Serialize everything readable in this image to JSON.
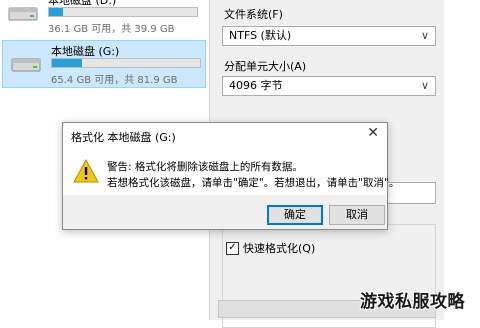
{
  "explorer": {
    "drives": [
      {
        "name": "本地磁盘 (D:)",
        "free_text": "36.1 GB 可用，共 39.9 GB",
        "used_fraction": 0.095,
        "icon": "hard-drive-icon"
      },
      {
        "name": "本地磁盘 (G:)",
        "free_text": "65.4 GB 可用，共 81.9 GB",
        "used_fraction": 0.2,
        "icon": "hard-drive-icon"
      }
    ]
  },
  "format_dialog": {
    "filesystem_label": "文件系统(F)",
    "filesystem_value": "NTFS (默认)",
    "allocation_label": "分配单元大小(A)",
    "allocation_value": "4096 字节",
    "quick_format_label": "快速格式化(Q)",
    "quick_format_checked": true
  },
  "message_box": {
    "title": "格式化 本地磁盘 (G:)",
    "line1": "警告: 格式化将删除该磁盘上的所有数据。",
    "line2": "若想格式化该磁盘，请单击\"确定\"。若想退出，请单击\"取消\"。",
    "ok_label": "确定",
    "cancel_label": "取消",
    "close_glyph": "✕",
    "icon": "warning-icon"
  },
  "watermark": {
    "text": "游戏私服攻略"
  },
  "colors": {
    "selection": "#cce8ff",
    "bar_fill": "#26a0da",
    "accent": "#0078d7",
    "warning": "#f2c811"
  }
}
